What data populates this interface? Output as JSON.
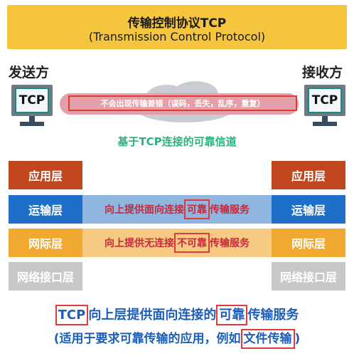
{
  "title": {
    "line1": "传输控制协议TCP",
    "line2": "(Transmission Control Protocol)"
  },
  "sender": {
    "label": "发送方",
    "screen": "TCP"
  },
  "receiver": {
    "label": "接收方",
    "screen": "TCP"
  },
  "connection": {
    "pipe_text": "不会出现传输差错（误码，丢失，乱序，重复）",
    "channel_label": "基于TCP连接的可靠信道"
  },
  "layers": [
    "应用层",
    "运输层",
    "网际层",
    "网络接口层"
  ],
  "bands": {
    "transport": {
      "prefix": "向上提供面向连接",
      "highlight": "可靠",
      "suffix": "传输服务"
    },
    "network": {
      "prefix": "向上提供无连接",
      "highlight": "不可靠",
      "suffix": "传输服务"
    }
  },
  "summary": {
    "line1": {
      "hl1": "TCP",
      "mid": "向上层提供面向连接的",
      "hl2": "可靠",
      "end": "传输服务"
    },
    "line2": {
      "start": "(适用于要求可靠传输的应用，例如",
      "hl": "文件传输",
      "end": ")"
    }
  },
  "colors": {
    "title_bg": "#f5c53d",
    "application": "#c0461e",
    "transport": "#1e6fc9",
    "network": "#f0a830",
    "link": "#c8c8c8",
    "transport_band": "#8fb6df",
    "network_band": "#f6ca82",
    "channel": "#2bb27e",
    "highlight_border": "#e23a3a",
    "summary_text": "#1c5fb8"
  }
}
